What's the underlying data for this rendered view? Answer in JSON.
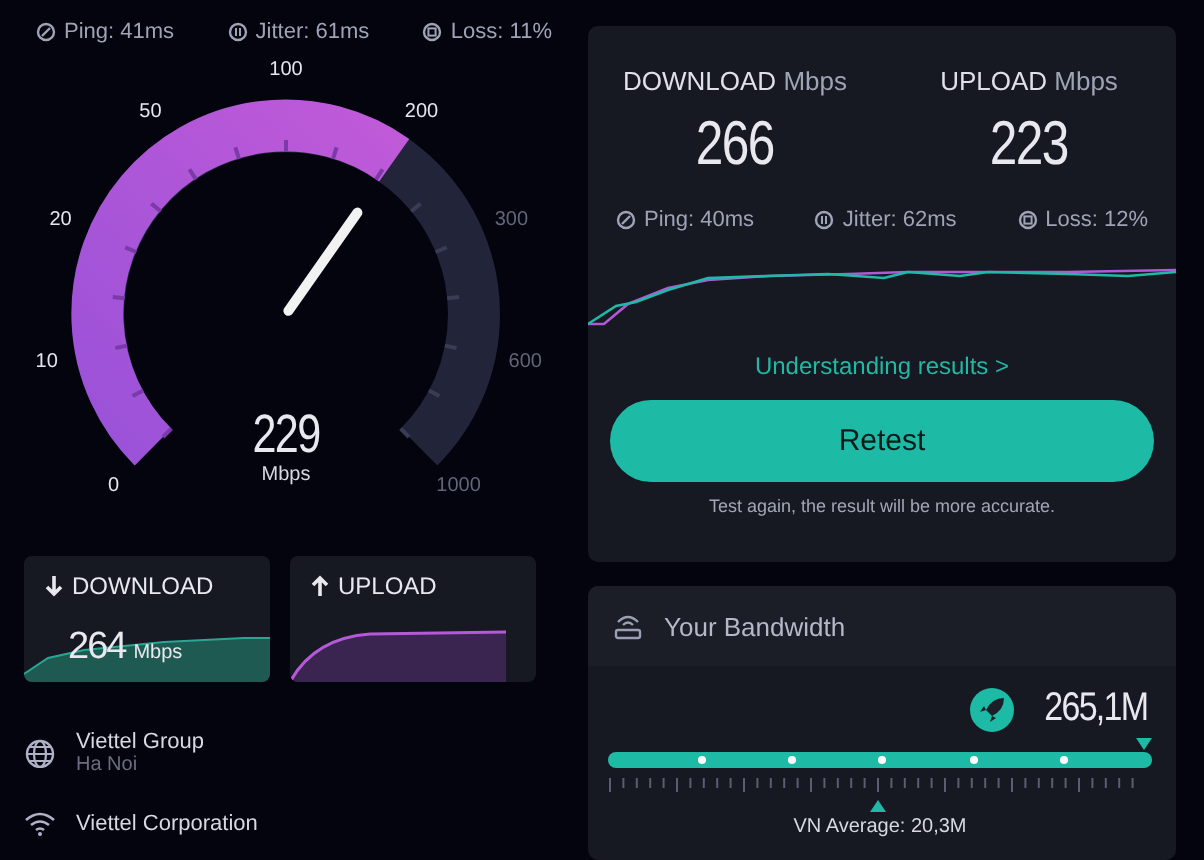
{
  "left_stats": [
    {
      "kind": "ping",
      "label": "Ping: 41ms"
    },
    {
      "kind": "jitter",
      "label": "Jitter: 61ms"
    },
    {
      "kind": "loss",
      "label": "Loss: 11%"
    }
  ],
  "gauge": {
    "scale": [
      "0",
      "10",
      "20",
      "50",
      "100",
      "200",
      "300",
      "600",
      "1000"
    ],
    "value": "229",
    "unit": "Mbps"
  },
  "mini_cards": [
    {
      "kind": "download",
      "title": "DOWNLOAD",
      "value": "264",
      "unit": "Mbps"
    },
    {
      "kind": "upload",
      "title": "UPLOAD"
    }
  ],
  "isp": [
    {
      "kind": "globe",
      "name": "Viettel Group",
      "location": "Ha Noi"
    },
    {
      "kind": "wifi",
      "name": "Viettel Corporation"
    }
  ],
  "results": {
    "columns": [
      {
        "label": "DOWNLOAD",
        "unit": "Mbps",
        "value": "266"
      },
      {
        "label": "UPLOAD",
        "unit": "Mbps",
        "value": "223"
      }
    ],
    "stats": [
      {
        "kind": "ping",
        "label": "Ping: 40ms"
      },
      {
        "kind": "jitter",
        "label": "Jitter: 62ms"
      },
      {
        "kind": "loss",
        "label": "Loss: 12%"
      }
    ],
    "link": "Understanding results >",
    "button": "Retest",
    "note": "Test again, the result will be more accurate."
  },
  "bandwidth": {
    "title": "Your Bandwidth",
    "value": "265,1M",
    "average": "VN Average: 20,3M"
  }
}
